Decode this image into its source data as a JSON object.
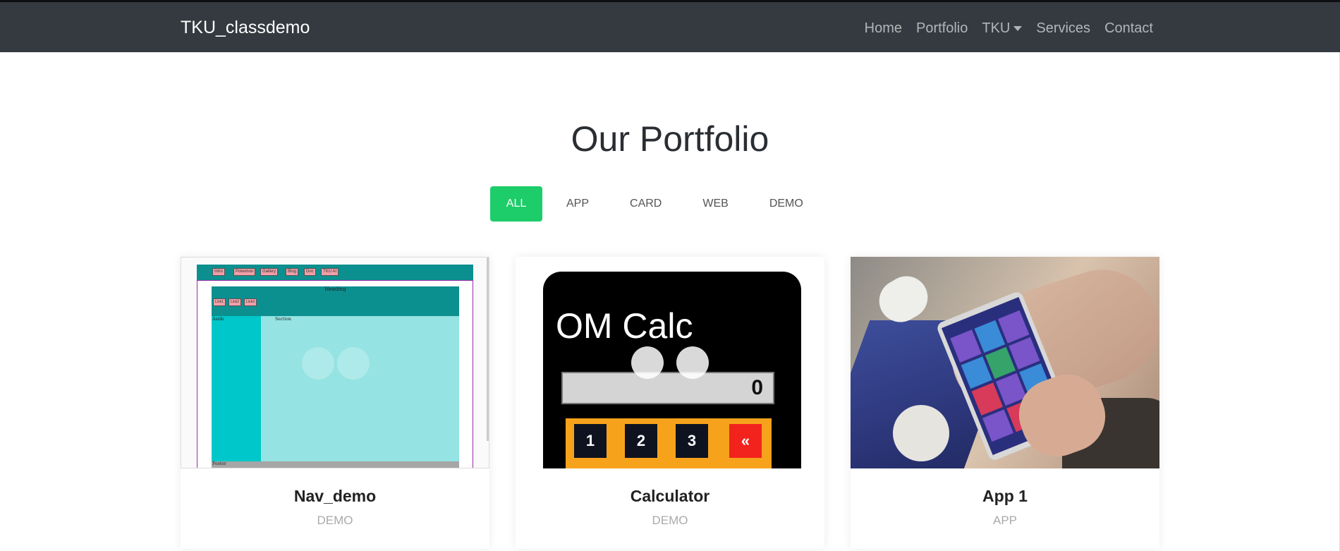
{
  "navbar": {
    "brand": "TKU_classdemo",
    "links": [
      {
        "label": "Home"
      },
      {
        "label": "Portfolio"
      },
      {
        "label": "TKU"
      },
      {
        "label": "Services"
      },
      {
        "label": "Contact"
      }
    ]
  },
  "portfolio": {
    "heading": "Our Portfolio",
    "filters": [
      "ALL",
      "APP",
      "CARD",
      "WEB",
      "DEMO"
    ],
    "active_filter": "ALL",
    "accent_color": "#1dcd69",
    "cards": [
      {
        "title": "Nav_demo",
        "category": "DEMO",
        "thumb": {
          "nav_buttons": [
            "Intro",
            "Pokemon",
            "Gallery",
            "Blog",
            "Doc",
            "TKU AI"
          ],
          "heading": "Heading",
          "links": [
            "Link1",
            "Link2",
            "Link3"
          ],
          "aside_label": "Aside",
          "section_label": "Section",
          "footer_label": "Footer"
        }
      },
      {
        "title": "Calculator",
        "category": "DEMO",
        "thumb": {
          "calc_title": "OM Calc",
          "display_value": "0",
          "keys": [
            "1",
            "2",
            "3",
            "«"
          ]
        }
      },
      {
        "title": "App 1",
        "category": "APP",
        "thumb": {}
      }
    ]
  }
}
